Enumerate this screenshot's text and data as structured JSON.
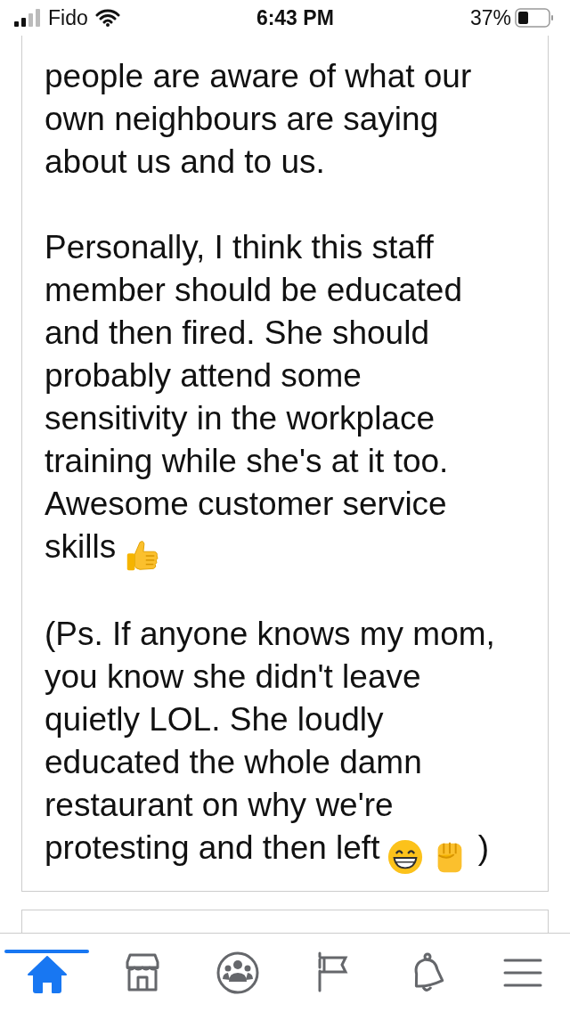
{
  "status_bar": {
    "carrier": "Fido",
    "time": "6:43 PM",
    "battery": "37%"
  },
  "post": {
    "paragraphs": [
      {
        "lines": [
          [
            {
              "kind": "text",
              "text": "people are aware of what our"
            }
          ],
          [
            {
              "kind": "text",
              "text": "own neighbours are saying"
            }
          ],
          [
            {
              "kind": "text",
              "text": "about us and to us."
            }
          ]
        ]
      },
      {
        "lines": [
          [
            {
              "kind": "text",
              "text": "Personally, I think this staff"
            }
          ],
          [
            {
              "kind": "text",
              "text": "member should be educated"
            }
          ],
          [
            {
              "kind": "text",
              "text": "and then fired. She should"
            }
          ],
          [
            {
              "kind": "text",
              "text": "probably attend some"
            }
          ],
          [
            {
              "kind": "text",
              "text": "sensitivity in the workplace"
            }
          ],
          [
            {
              "kind": "text",
              "text": "training while she's at it too."
            }
          ],
          [
            {
              "kind": "text",
              "text": "Awesome customer service"
            }
          ],
          [
            {
              "kind": "text",
              "text": "skills"
            },
            {
              "kind": "thumbs_up"
            }
          ]
        ]
      },
      {
        "lines": [
          [
            {
              "kind": "text",
              "text": "(Ps. If anyone knows my mom,"
            }
          ],
          [
            {
              "kind": "text",
              "text": "you know she didn't leave"
            }
          ],
          [
            {
              "kind": "text",
              "text": "quietly LOL. She loudly"
            }
          ],
          [
            {
              "kind": "text",
              "text": "educated the whole damn"
            }
          ],
          [
            {
              "kind": "text",
              "text": "restaurant on why we're"
            }
          ],
          [
            {
              "kind": "text",
              "text": "protesting and then left"
            },
            {
              "kind": "grin"
            },
            {
              "kind": "fist"
            },
            {
              "kind": "text",
              "text": ")"
            }
          ]
        ]
      }
    ]
  },
  "nav": [
    {
      "kind": "home",
      "selected": true
    },
    {
      "kind": "marketplace",
      "selected": false
    },
    {
      "kind": "groups",
      "selected": false
    },
    {
      "kind": "pages",
      "selected": false
    },
    {
      "kind": "notifications",
      "selected": false
    },
    {
      "kind": "menu",
      "selected": false
    }
  ]
}
